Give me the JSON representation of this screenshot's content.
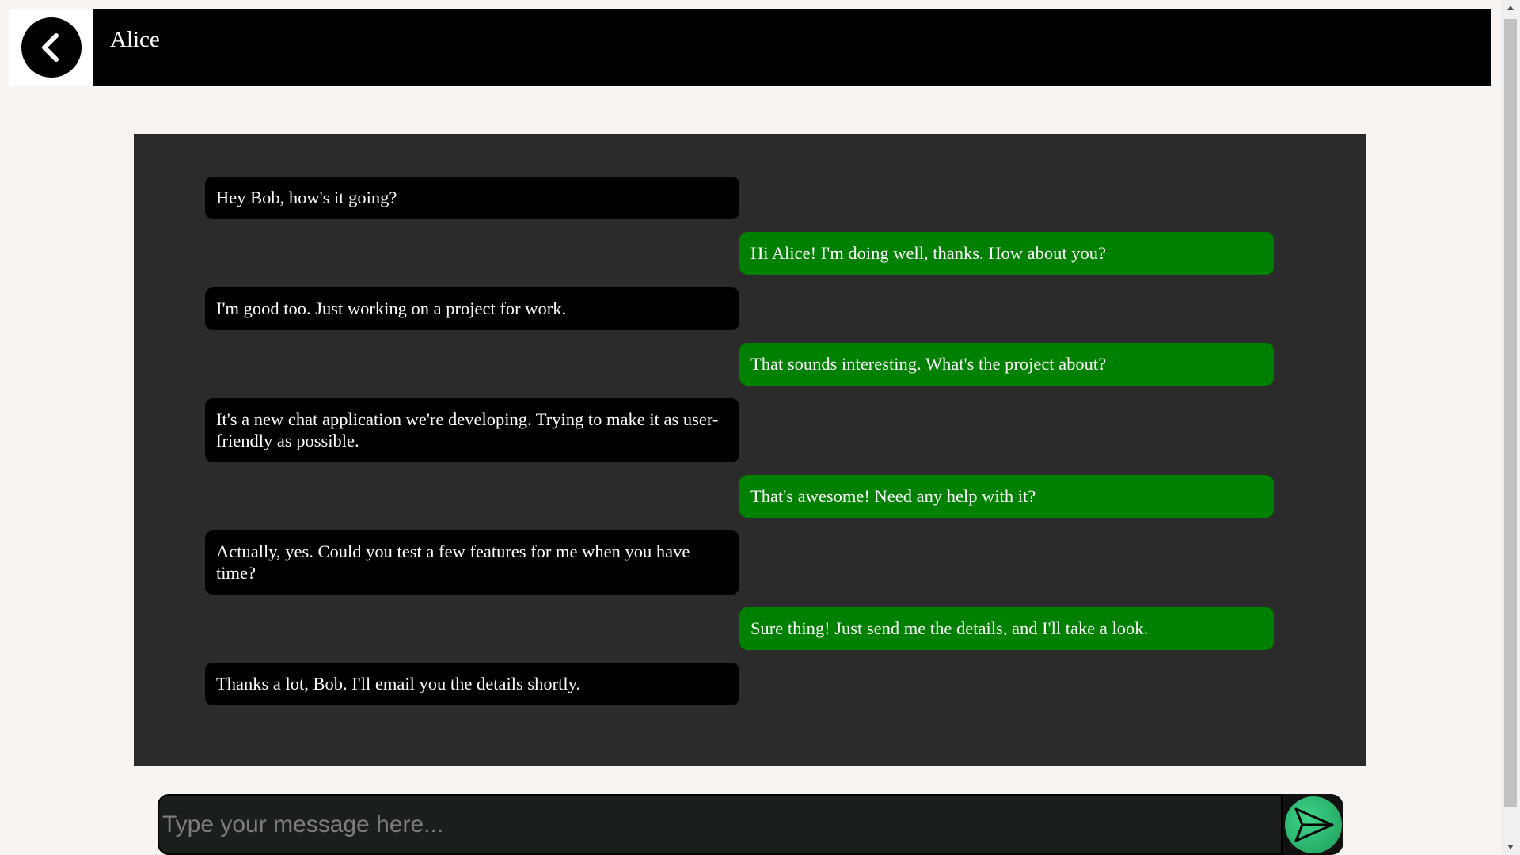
{
  "header": {
    "title": "Alice",
    "back_icon": "chevron-left-icon"
  },
  "messages": [
    {
      "side": "received",
      "text": "Hey Bob, how's it going?"
    },
    {
      "side": "sent",
      "text": "Hi Alice! I'm doing well, thanks. How about you?"
    },
    {
      "side": "received",
      "text": "I'm good too. Just working on a project for work."
    },
    {
      "side": "sent",
      "text": "That sounds interesting. What's the project about?"
    },
    {
      "side": "received",
      "text": "It's a new chat application we're developing. Trying to make it as user-friendly as possible."
    },
    {
      "side": "sent",
      "text": "That's awesome! Need any help with it?"
    },
    {
      "side": "received",
      "text": "Actually, yes. Could you test a few features for me when you have time?"
    },
    {
      "side": "sent",
      "text": "Sure thing! Just send me the details, and I'll take a look."
    },
    {
      "side": "received",
      "text": "Thanks a lot, Bob. I'll email you the details shortly."
    }
  ],
  "composer": {
    "placeholder": "Type your message here...",
    "value": "",
    "send_icon": "send-icon"
  },
  "colors": {
    "header_bg": "#000000",
    "panel_bg": "#2b2b2b",
    "received_bubble": "#000000",
    "sent_bubble": "#008000",
    "send_button": "#2ecc71",
    "page_bg": "#f7f4f1"
  }
}
